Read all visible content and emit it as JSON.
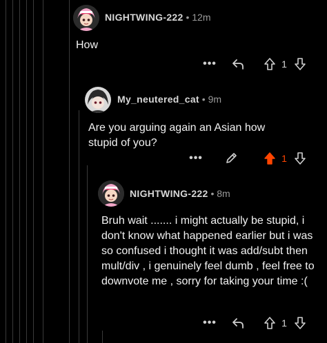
{
  "comments": [
    {
      "user": "NIGHTWING-222",
      "time": "12m",
      "body": "How",
      "vote_count": "1",
      "upvoted": false,
      "action": "reply"
    },
    {
      "user": "My_neutered_cat",
      "time": "9m",
      "body": "Are you arguing again an Asian how stupid of you?",
      "vote_count": "1",
      "upvoted": true,
      "action": "edit"
    },
    {
      "user": "NIGHTWING-222",
      "time": "8m",
      "body": "Bruh wait ....... i might actually be stupid, i don't know what happened earlier but i was so confused i thought it was add/subt then mult/div , i genuinely feel dumb , feel free to downvote me , sorry for taking your time :(",
      "vote_count": "1",
      "upvoted": false,
      "action": "reply"
    }
  ],
  "separator": "•",
  "more_label": "•••",
  "colors": {
    "upvote_active": "#ff4500",
    "thread_line": "#3a3a3a",
    "text_muted": "#9a9a9a"
  },
  "icons": {
    "avatar_1": "pink-hair-avatar-icon",
    "avatar_2": "dark-hair-avatar-icon",
    "reply": "reply-arrow-icon",
    "edit": "pencil-icon",
    "upvote": "upvote-arrow-icon",
    "downvote": "downvote-arrow-icon"
  }
}
